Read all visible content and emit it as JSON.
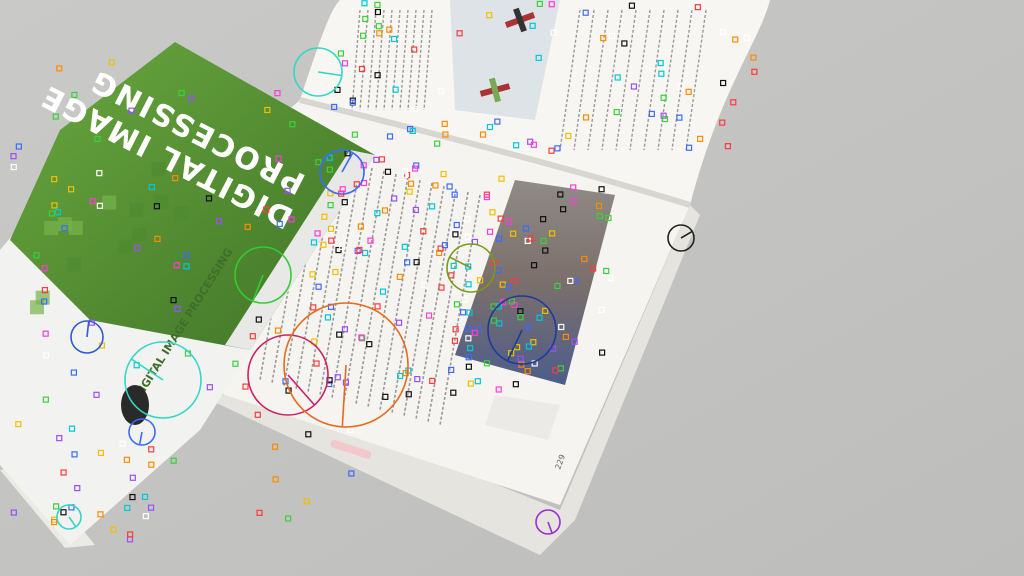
{
  "cover": {
    "title_line1": "DIGITAL IMAGE",
    "title_line2": "PROCESSING",
    "spine_text": "DIGITAL IMAGE PROCESSING",
    "color_green": "#5e9b3a",
    "color_green_dark": "#4a7f2c"
  },
  "page_numbers": {
    "right_page": "229"
  },
  "overlay": {
    "type": "keypoint-features",
    "marker_shapes": [
      "circle-with-orientation-line",
      "small-square"
    ]
  },
  "colors": {
    "background": "#c3c3c1",
    "paper": "#f4f3ef"
  }
}
